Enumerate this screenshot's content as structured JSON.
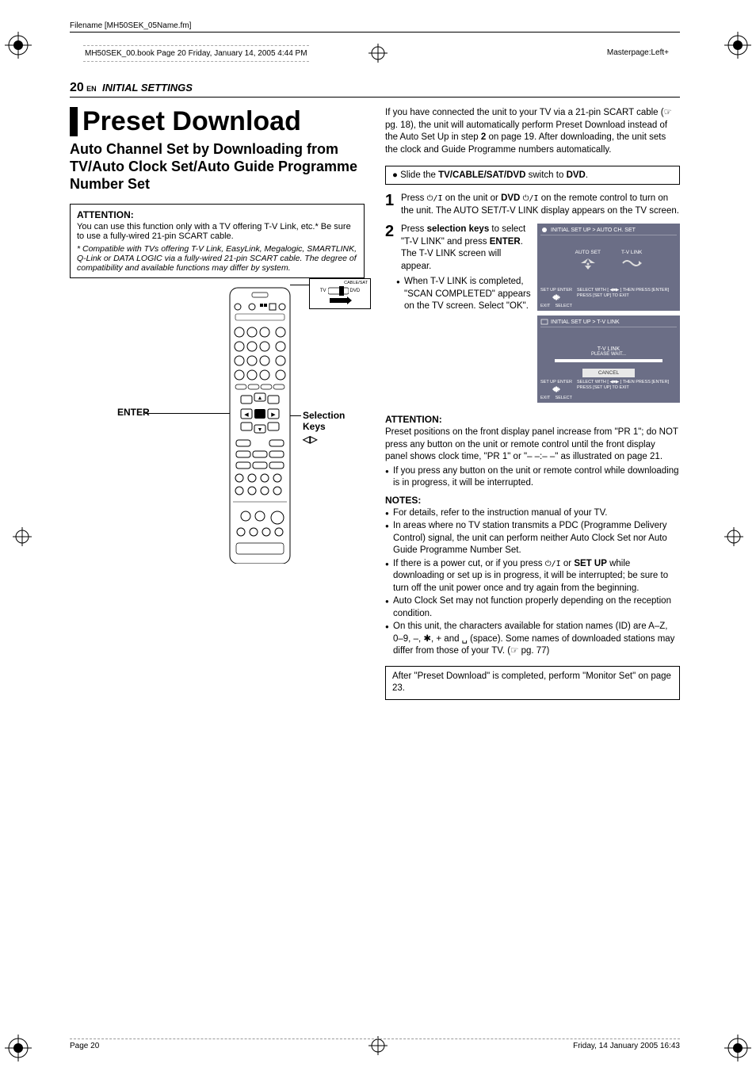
{
  "meta": {
    "filename_line": "Filename [MH50SEK_05Name.fm]",
    "book_line": "MH50SEK_00.book  Page 20  Friday, January 14, 2005  4:44 PM",
    "masterpage": "Masterpage:Left+"
  },
  "page_header": {
    "page_num": "20",
    "lang": "EN",
    "section": "INITIAL SETTINGS"
  },
  "left": {
    "title": "Preset Download",
    "subtitle": "Auto Channel Set by Downloading from TV/Auto Clock Set/Auto Guide Programme Number Set",
    "attention": {
      "label": "ATTENTION:",
      "body": "You can use this function only with a TV offering T-V Link, etc.* Be sure to use a fully-wired 21-pin SCART cable.",
      "footnote": "* Compatible with TVs offering T-V Link, EasyLink, Megalogic, SMARTLINK, Q-Link or DATA LOGIC via a fully-wired 21-pin SCART cable. The degree of compatibility and available functions may differ by system."
    },
    "remote": {
      "enter_label": "ENTER",
      "selection_keys_label": "Selection Keys",
      "switch_label_cablesat": "CABLE/SAT",
      "switch_label_tv": "TV",
      "switch_label_dvd": "DVD"
    }
  },
  "right": {
    "intro": "If you have connected the unit to your TV via a 21-pin SCART cable (☞ pg. 18), the unit will automatically perform Preset Download instead of the Auto Set Up in step 2 on page 19. After downloading, the unit sets the clock and Guide Programme numbers automatically.",
    "slide_box": "● Slide the TV/CABLE/SAT/DVD switch to DVD.",
    "step1": {
      "num": "1",
      "text": "Press ⏻/I on the unit or DVD ⏻/I on the remote control to turn on the unit. The AUTO SET/T-V LINK display appears on the TV screen."
    },
    "step2": {
      "num": "2",
      "text_a": "Press selection keys to select \"T-V LINK\" and press ENTER. The T-V LINK screen will appear.",
      "bullet": "When T-V LINK is completed, \"SCAN COMPLETED\" appears on the TV screen. Select \"OK\"."
    },
    "tv1": {
      "breadcrumb": "INITIAL SET UP > AUTO CH. SET",
      "opt_auto": "AUTO SET",
      "opt_tvlink": "T-V LINK",
      "foot_setup": "SET UP",
      "foot_enter": "ENTER",
      "foot_exit": "EXIT",
      "foot_select": "SELECT",
      "foot_right": "SELECT WITH [ ◀■▶ ] THEN PRESS [ENTER]\nPRESS [SET UP] TO EXIT"
    },
    "tv2": {
      "breadcrumb": "INITIAL SET UP > T-V LINK",
      "center_label": "T-V LINK",
      "please_wait": "PLEASE WAIT...",
      "cancel": "CANCEL",
      "foot_setup": "SET UP",
      "foot_enter": "ENTER",
      "foot_exit": "EXIT",
      "foot_select": "SELECT",
      "foot_right": "SELECT WITH [ ◀■▶ ] THEN PRESS [ENTER]\nPRESS [SET UP] TO EXIT"
    },
    "attention2": {
      "label": "ATTENTION:",
      "body": "Preset positions on the front display panel increase from \"PR 1\"; do NOT press any button on the unit or remote control until the front display panel shows clock time, \"PR 1\" or \"– –:– –\" as illustrated on page 21.",
      "bullet": "If you press any button on the unit or remote control while downloading is in progress, it will be interrupted."
    },
    "notes": {
      "label": "NOTES:",
      "items": [
        "For details, refer to the instruction manual of your TV.",
        "In areas where no TV station transmits a PDC (Programme Delivery Control) signal, the unit can perform neither Auto Clock Set nor Auto Guide Programme Number Set.",
        "If there is a power cut, or if you press ⏻/I or SET UP while downloading or set up is in progress, it will be interrupted; be sure to turn off the unit power once and try again from the beginning.",
        "Auto Clock Set may not function properly depending on the reception condition.",
        "On this unit, the characters available for station names (ID) are A–Z, 0–9, –, ✱, + and ␣ (space). Some names of downloaded stations may differ from those of your TV. (☞ pg. 77)"
      ]
    },
    "after_box": "After \"Preset Download\" is completed, perform \"Monitor Set\" on page 23."
  },
  "footer": {
    "left": "Page 20",
    "right": "Friday, 14 January 2005  16:43"
  }
}
